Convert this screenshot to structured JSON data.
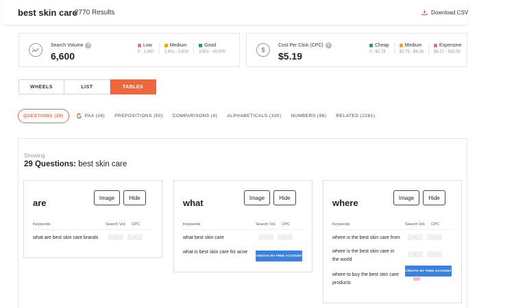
{
  "header": {
    "query": "best skin care",
    "results": "2770 Results",
    "download_label": "Download CSV"
  },
  "volume": {
    "label": "Search Volume",
    "value": "6,600",
    "legend": [
      {
        "name": "Low",
        "range": "0 - 1,600",
        "color": "#f07070"
      },
      {
        "name": "Medium",
        "range": "1,601 - 3,600",
        "color": "#f0a030"
      },
      {
        "name": "Good",
        "range": "3,601 - 40,500",
        "color": "#20a060"
      }
    ]
  },
  "cpc": {
    "label": "Cost Per Click (CPC)",
    "value": "$5.19",
    "legend": [
      {
        "name": "Cheap",
        "range": "0 - $2.78",
        "color": "#20a060"
      },
      {
        "name": "Medium",
        "range": "$2.79 - $6.26",
        "color": "#f0a030"
      },
      {
        "name": "Expensive",
        "range": "$6.27 - $15.06",
        "color": "#f07070"
      }
    ]
  },
  "view_tabs": [
    "WHEELS",
    "LIST",
    "TABLES"
  ],
  "category_tabs": [
    "QUESTIONS (29)",
    "PAA (26)",
    "PREPOSITIONS (50)",
    "COMPARISONS (4)",
    "ALPHABETICALS (330)",
    "NUMBERS (96)",
    "RELATED (2261)"
  ],
  "panel": {
    "showing": "Showing",
    "heading_bold": "29 Questions:",
    "heading_rest": "best skin care"
  },
  "card_common": {
    "image_label": "Image",
    "hide_label": "Hide",
    "col_keywords": "Keywords",
    "col_volume": "Search Vol.",
    "col_cpc": "CPC",
    "pill": "-",
    "cta": "CREATE MY FREE ACCOUNT"
  },
  "cards": [
    {
      "title": "are",
      "rows": [
        "what are best skin care brands"
      ]
    },
    {
      "title": "what",
      "rows": [
        "what best skin care",
        "what is best skin care for acne"
      ]
    },
    {
      "title": "where",
      "rows": [
        "where is the best skin care from",
        "where is the best skin care in the world",
        "where to buy the best skin care products"
      ]
    }
  ]
}
